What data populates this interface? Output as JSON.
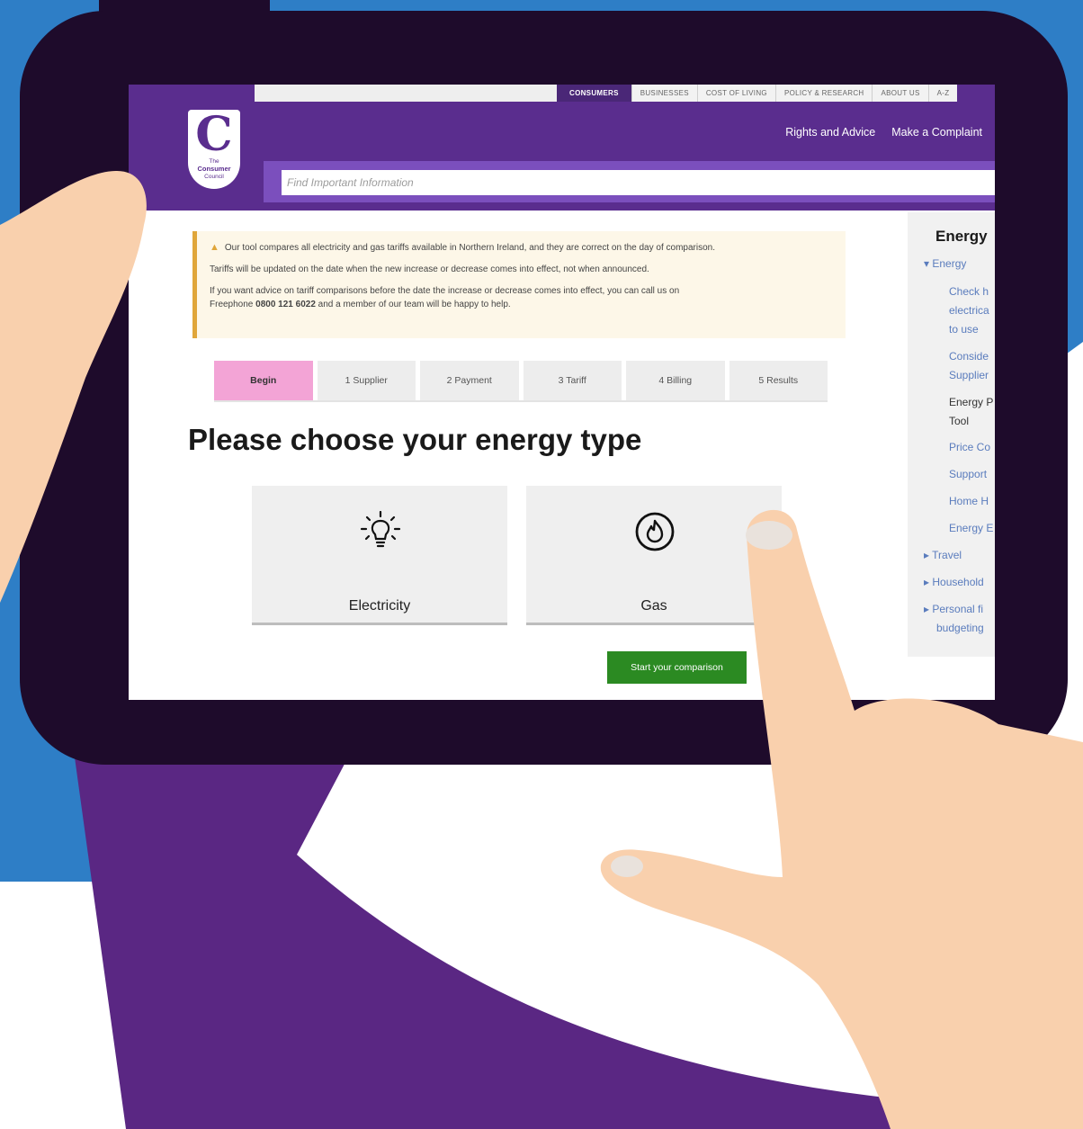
{
  "utility_nav": {
    "tabs": [
      {
        "label": "CONSUMERS",
        "active": true
      },
      {
        "label": "BUSINESSES"
      },
      {
        "label": "COST OF LIVING"
      },
      {
        "label": "POLICY & RESEARCH"
      },
      {
        "label": "ABOUT US"
      },
      {
        "label": "A-Z"
      }
    ]
  },
  "header": {
    "logo": {
      "line1": "The",
      "line2": "Consumer",
      "line3": "Council"
    },
    "links": [
      "Rights and Advice",
      "Make a Complaint"
    ],
    "search_placeholder": "Find Important Information"
  },
  "alert": {
    "line1": "Our tool compares all electricity and gas tariffs available in Northern Ireland, and they are correct on the day of comparison.",
    "line2": "Tariffs will be updated on the date when the new increase or decrease comes into effect, not when announced.",
    "line3": "If you want advice on tariff comparisons before the date the increase or decrease comes into effect, you can call us on",
    "line4_pre": "Freephone ",
    "phone": "0800 121 6022",
    "line4_post": " and a member of our team will be happy to help."
  },
  "steps": [
    "Begin",
    "1 Supplier",
    "2 Payment",
    "3 Tariff",
    "4 Billing",
    "5 Results"
  ],
  "main": {
    "title": "Please choose your energy type",
    "options": [
      {
        "label": "Electricity",
        "icon": "lightbulb-icon"
      },
      {
        "label": "Gas",
        "icon": "flame-icon"
      }
    ],
    "start_label": "Start your comparison"
  },
  "sidebar": {
    "title": "Energy",
    "items": [
      "▾ Energy",
      "Check h",
      "electrica",
      "to use",
      "Conside",
      "Supplier",
      "Energy P",
      "Tool",
      "Price Co",
      "Support",
      "Home H",
      "Energy E",
      "▸ Travel",
      "▸ Household",
      "▸ Personal fi",
      "budgeting"
    ]
  },
  "colors": {
    "brand_purple": "#5a2d8e",
    "tablet_frame": "#1e0b2b",
    "accent_blue": "#2e7ec6",
    "active_step": "#f3a4d6",
    "start_button": "#2b8a22",
    "warning": "#e0a63a"
  }
}
